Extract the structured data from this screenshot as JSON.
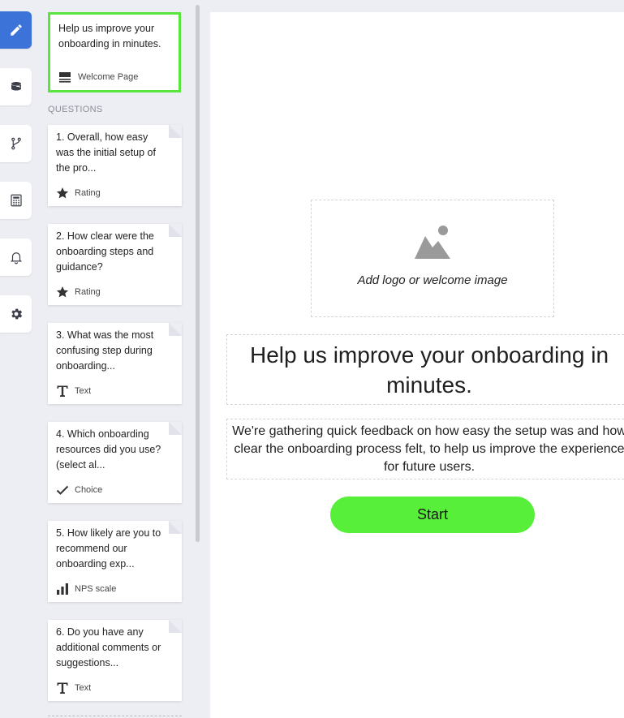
{
  "rail": {
    "items": [
      {
        "name": "edit",
        "icon": "pencil-icon",
        "active": true
      },
      {
        "name": "theme",
        "icon": "paint-bucket-icon",
        "active": false
      },
      {
        "name": "logic",
        "icon": "branch-icon",
        "active": false
      },
      {
        "name": "calculator",
        "icon": "calculator-icon",
        "active": false
      },
      {
        "name": "notifications",
        "icon": "bell-icon",
        "active": false
      },
      {
        "name": "settings",
        "icon": "gear-icon",
        "active": false
      }
    ]
  },
  "welcome_card": {
    "title": "Help us improve your onboarding in minutes.",
    "type_label": "Welcome Page",
    "type_icon": "welcome-page-icon"
  },
  "questions_label": "QUESTIONS",
  "questions": [
    {
      "title": "1. Overall, how easy was the initial setup of the pro...",
      "type_label": "Rating",
      "type_icon": "star-icon"
    },
    {
      "title": "2. How clear were the onboarding steps and guidance?",
      "type_label": "Rating",
      "type_icon": "star-icon"
    },
    {
      "title": "3. What was the most confusing step during onboarding...",
      "type_label": "Text",
      "type_icon": "text-t-icon"
    },
    {
      "title": "4. Which onboarding resources did you use? (select al...",
      "type_label": "Choice",
      "type_icon": "checkmark-icon"
    },
    {
      "title": "5. How likely are you to recommend our onboarding exp...",
      "type_label": "NPS scale",
      "type_icon": "bar-chart-icon"
    },
    {
      "title": "6. Do you have any additional comments or suggestions...",
      "type_label": "Text",
      "type_icon": "text-t-icon"
    }
  ],
  "canvas": {
    "image_caption": "Add logo or welcome image",
    "heading": "Help us improve your onboarding in minutes.",
    "description": "We're gathering quick feedback on how easy the setup was and how clear the onboarding process felt, to help us improve the experience for future users.",
    "start_label": "Start"
  },
  "colors": {
    "accent_blue": "#3b73d9",
    "selected_border": "#5ae53d",
    "start_button": "#57ef3a"
  }
}
